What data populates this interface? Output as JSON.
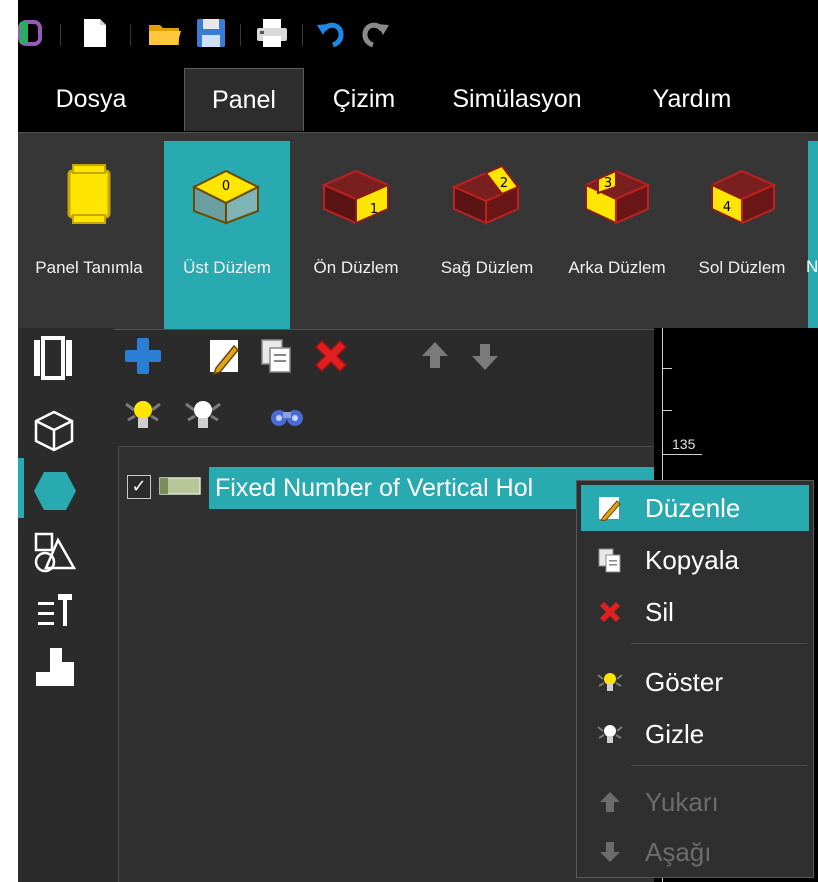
{
  "menu": {
    "tabs": [
      {
        "label": "Dosya"
      },
      {
        "label": "Panel"
      },
      {
        "label": "Çizim"
      },
      {
        "label": "Simülasyon"
      },
      {
        "label": "Yardım"
      }
    ]
  },
  "ribbon": {
    "buttons": [
      {
        "label": "Panel Tanımla"
      },
      {
        "label": "Üst Düzlem",
        "badge": "0"
      },
      {
        "label": "Ön Düzlem",
        "badge": "1"
      },
      {
        "label": "Sağ Düzlem",
        "badge": "2"
      },
      {
        "label": "Arka Düzlem",
        "badge": "3"
      },
      {
        "label": "Sol Düzlem",
        "badge": "4"
      }
    ],
    "overflow_label": "N"
  },
  "tree": {
    "node_label": "Fixed Number of Vertical Hol",
    "checked": "✓"
  },
  "ruler": {
    "label": "135"
  },
  "context_menu": {
    "items": [
      {
        "label": "Düzenle",
        "icon": "pencil-icon"
      },
      {
        "label": "Kopyala",
        "icon": "copy-icon"
      },
      {
        "label": "Sil",
        "icon": "delete-icon"
      },
      {
        "label": "Göster",
        "icon": "bulb-on-icon"
      },
      {
        "label": "Gizle",
        "icon": "bulb-off-icon"
      },
      {
        "label": "Yukarı",
        "icon": "arrow-up-icon"
      },
      {
        "label": "Aşağı",
        "icon": "arrow-down-icon"
      }
    ]
  },
  "colors": {
    "accent": "#28aab0",
    "face_yellow": "#ffe600",
    "cube_red": "#8b1a1a"
  }
}
